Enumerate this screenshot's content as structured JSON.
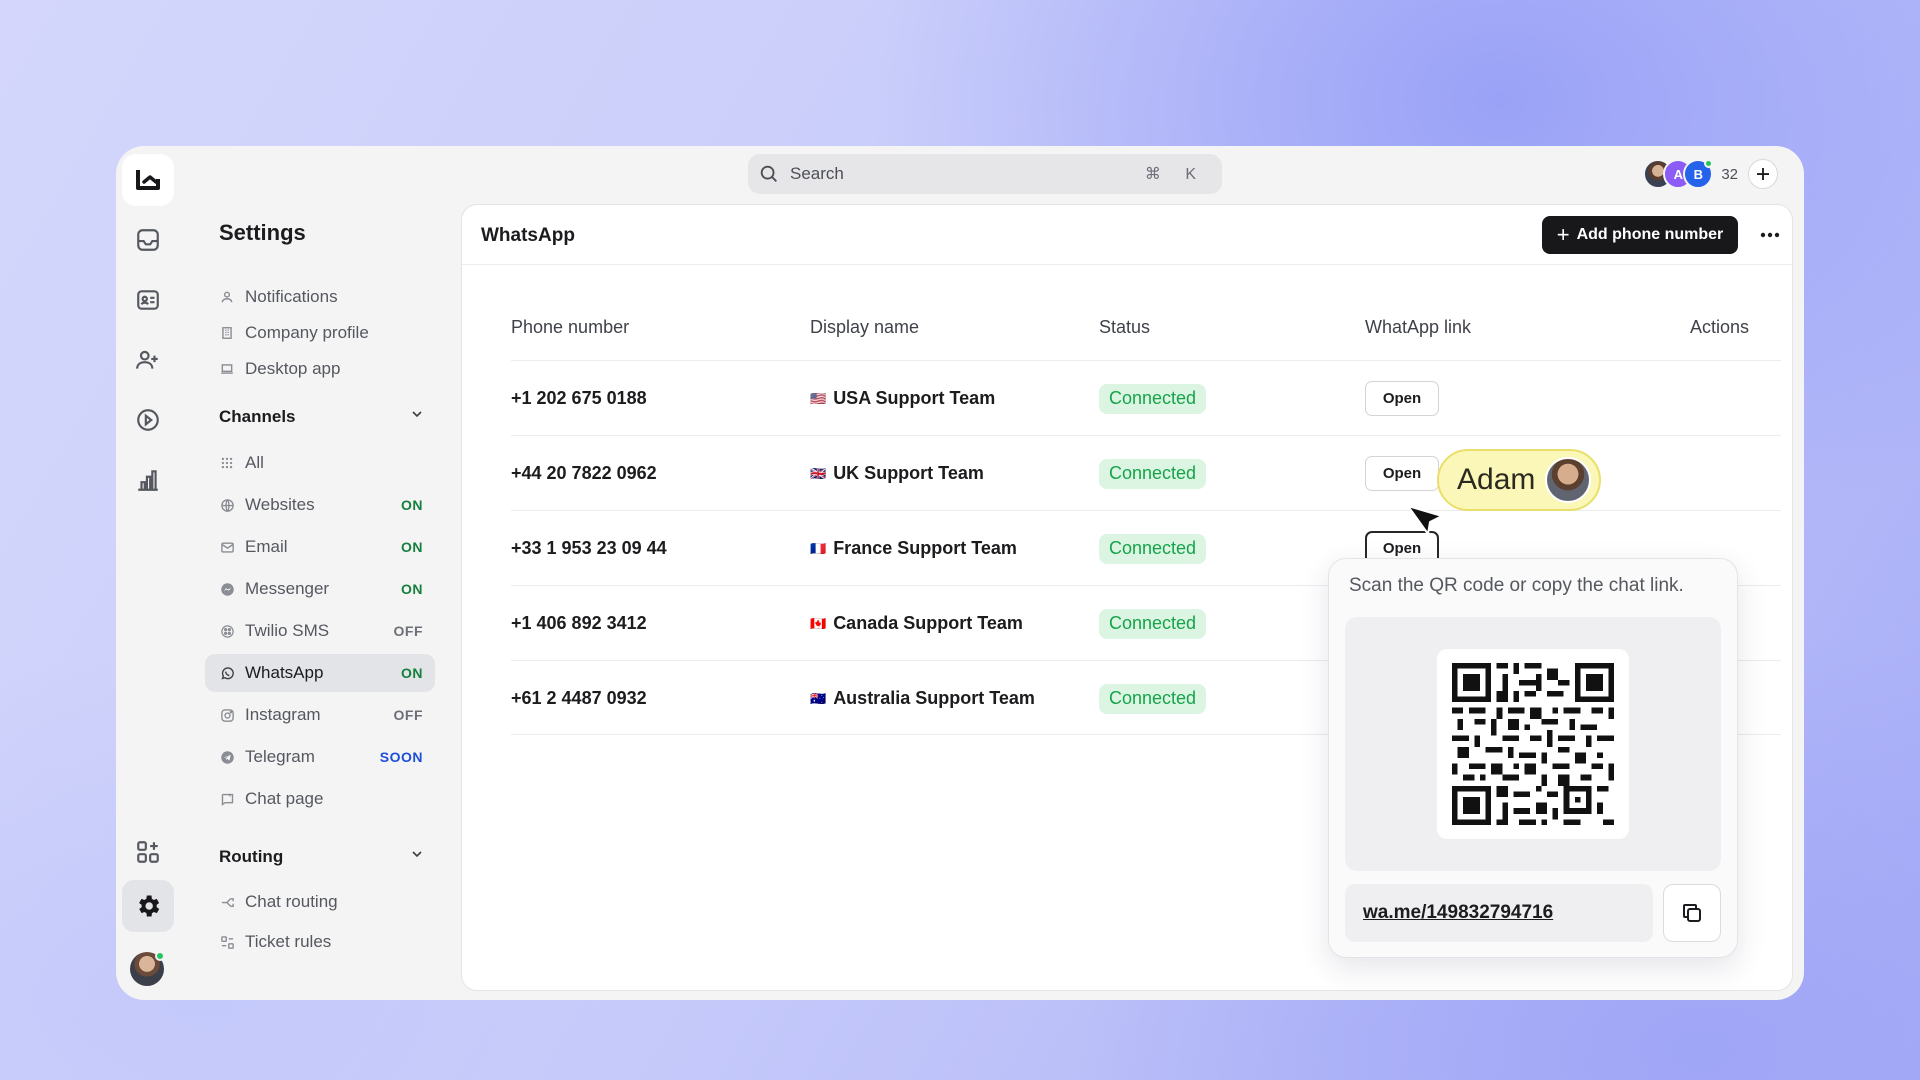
{
  "search": {
    "placeholder": "Search",
    "shortcut": "⌘ K"
  },
  "presence": {
    "avatars": [
      "A",
      "B"
    ],
    "count": "32"
  },
  "settings": {
    "title": "Settings",
    "general": [
      {
        "label": "Notifications",
        "icon": "person-icon"
      },
      {
        "label": "Company profile",
        "icon": "building-icon"
      },
      {
        "label": "Desktop app",
        "icon": "laptop-icon"
      }
    ],
    "channels_title": "Channels",
    "channels": [
      {
        "label": "All",
        "badge": "",
        "icon": "grid-icon"
      },
      {
        "label": "Websites",
        "badge": "ON",
        "icon": "globe-icon"
      },
      {
        "label": "Email",
        "badge": "ON",
        "icon": "mail-icon"
      },
      {
        "label": "Messenger",
        "badge": "ON",
        "icon": "messenger-icon"
      },
      {
        "label": "Twilio SMS",
        "badge": "OFF",
        "icon": "twilio-icon"
      },
      {
        "label": "WhatsApp",
        "badge": "ON",
        "icon": "whatsapp-icon"
      },
      {
        "label": "Instagram",
        "badge": "OFF",
        "icon": "instagram-icon"
      },
      {
        "label": "Telegram",
        "badge": "SOON",
        "icon": "telegram-icon"
      },
      {
        "label": "Chat page",
        "badge": "",
        "icon": "chat-page-icon"
      }
    ],
    "routing_title": "Routing",
    "routing": [
      {
        "label": "Chat routing",
        "icon": "route-icon"
      },
      {
        "label": "Ticket rules",
        "icon": "rules-icon"
      }
    ]
  },
  "main": {
    "title": "WhatsApp",
    "add_button": "Add phone number",
    "columns": [
      "Phone number",
      "Display name",
      "Status",
      "WhatApp link",
      "Actions"
    ],
    "rows": [
      {
        "phone": "+1 202 675 0188",
        "flag": "🇺🇸",
        "name": "USA Support Team",
        "status": "Connected",
        "link": "Open"
      },
      {
        "phone": "+44 20 7822 0962",
        "flag": "🇬🇧",
        "name": "UK Support Team",
        "status": "Connected",
        "link": "Open"
      },
      {
        "phone": "+33 1 953 23 09 44",
        "flag": "🇫🇷",
        "name": "France Support Team",
        "status": "Connected",
        "link": "Open"
      },
      {
        "phone": "+1 406 892 3412",
        "flag": "🇨🇦",
        "name": "Canada Support Team",
        "status": "Connected",
        "link": ""
      },
      {
        "phone": "+61 2 4487 0932",
        "flag": "🇦🇺",
        "name": "Australia Support Team",
        "status": "Connected",
        "link": ""
      }
    ]
  },
  "popover": {
    "instruction": "Scan the QR code or copy the chat link.",
    "link": "wa.me/149832794716"
  },
  "cursor": {
    "name": "Adam"
  },
  "colors": {
    "status_bg": "#dcf5e3",
    "status_text": "#16a34a",
    "primary_button": "#18181b",
    "cursor_label": "#fbf7b8"
  }
}
